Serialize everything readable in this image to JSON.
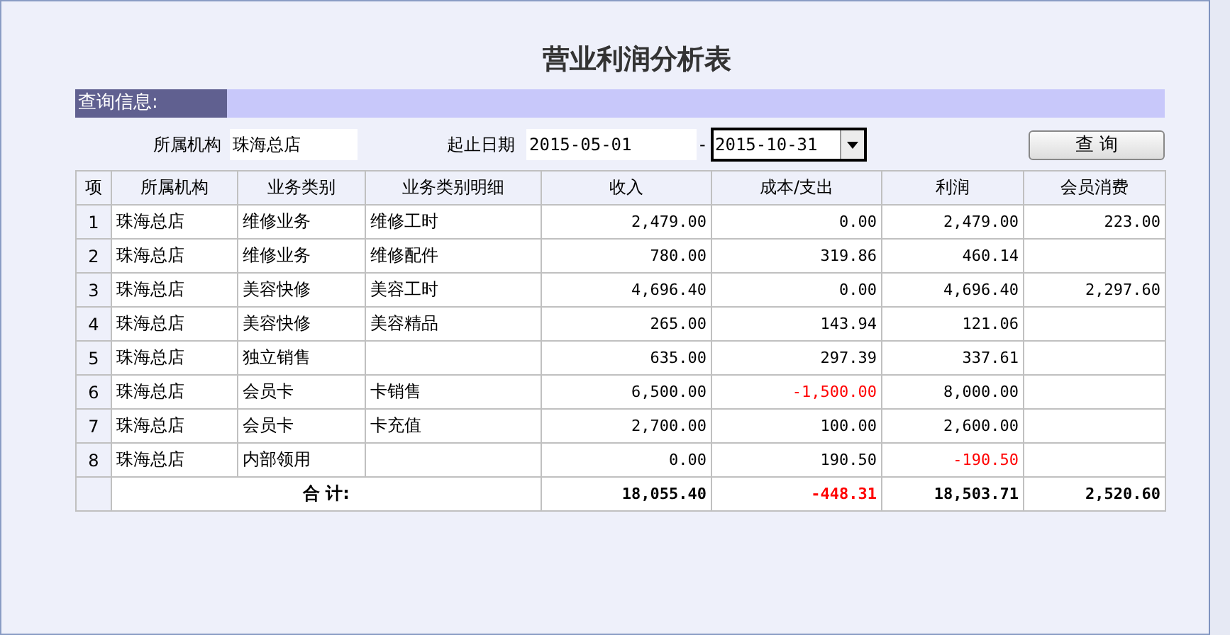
{
  "title": "营业利润分析表",
  "section": {
    "label": "查询信息:"
  },
  "query": {
    "org_label": "所属机构",
    "org_value": "珠海总店",
    "date_label": "起止日期",
    "start_date": "2015-05-01",
    "separator": "-",
    "end_date": "2015-10-31",
    "end_focused": true,
    "button": "查 询"
  },
  "table": {
    "columns": [
      "项",
      "所属机构",
      "业务类别",
      "业务类别明细",
      "收入",
      "成本/支出",
      "利润",
      "会员消费"
    ],
    "rows": [
      {
        "no": "1",
        "org": "珠海总店",
        "category": "维修业务",
        "detail": "维修工时",
        "income": {
          "text": "2,479.00",
          "negative": false
        },
        "cost": {
          "text": "0.00",
          "negative": false
        },
        "profit": {
          "text": "2,479.00",
          "negative": false
        },
        "member": {
          "text": "223.00",
          "negative": false
        }
      },
      {
        "no": "2",
        "org": "珠海总店",
        "category": "维修业务",
        "detail": "维修配件",
        "income": {
          "text": "780.00",
          "negative": false
        },
        "cost": {
          "text": "319.86",
          "negative": false
        },
        "profit": {
          "text": "460.14",
          "negative": false
        }
      },
      {
        "no": "3",
        "org": "珠海总店",
        "category": "美容快修",
        "detail": "美容工时",
        "income": {
          "text": "4,696.40",
          "negative": false
        },
        "cost": {
          "text": "0.00",
          "negative": false
        },
        "profit": {
          "text": "4,696.40",
          "negative": false
        },
        "member": {
          "text": "2,297.60",
          "negative": false
        }
      },
      {
        "no": "4",
        "org": "珠海总店",
        "category": "美容快修",
        "detail": "美容精品",
        "income": {
          "text": "265.00",
          "negative": false
        },
        "cost": {
          "text": "143.94",
          "negative": false
        },
        "profit": {
          "text": "121.06",
          "negative": false
        }
      },
      {
        "no": "5",
        "org": "珠海总店",
        "category": "独立销售",
        "income": {
          "text": "635.00",
          "negative": false
        },
        "cost": {
          "text": "297.39",
          "negative": false
        },
        "profit": {
          "text": "337.61",
          "negative": false
        }
      },
      {
        "no": "6",
        "org": "珠海总店",
        "category": "会员卡",
        "detail": "卡销售",
        "income": {
          "text": "6,500.00",
          "negative": false
        },
        "cost": {
          "text": "-1,500.00",
          "negative": true
        },
        "profit": {
          "text": "8,000.00",
          "negative": false
        }
      },
      {
        "no": "7",
        "org": "珠海总店",
        "category": "会员卡",
        "detail": "卡充值",
        "income": {
          "text": "2,700.00",
          "negative": false
        },
        "cost": {
          "text": "100.00",
          "negative": false
        },
        "profit": {
          "text": "2,600.00",
          "negative": false
        }
      },
      {
        "no": "8",
        "org": "珠海总店",
        "category": "内部领用",
        "income": {
          "text": "0.00",
          "negative": false
        },
        "cost": {
          "text": "190.50",
          "negative": false
        },
        "profit": {
          "text": "-190.50",
          "negative": true
        }
      }
    ],
    "total": {
      "label": "合 计:",
      "income": {
        "text": "18,055.40",
        "negative": false
      },
      "cost": {
        "text": "-448.31",
        "negative": true
      },
      "profit": {
        "text": "18,503.71",
        "negative": false
      },
      "member": {
        "text": "2,520.60",
        "negative": false
      }
    }
  }
}
